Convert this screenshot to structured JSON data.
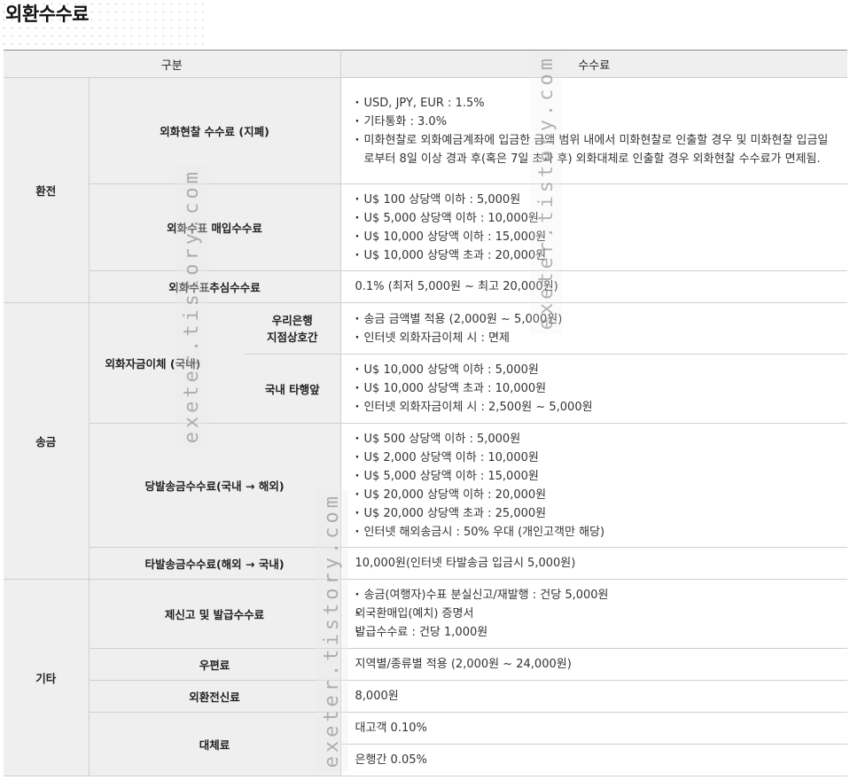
{
  "page": {
    "title": "외환수수료"
  },
  "header": {
    "col1": "구분",
    "col2": "수수료"
  },
  "categories": {
    "exchange": "환전",
    "remit": "송금",
    "other": "기타"
  },
  "rows": {
    "r1": {
      "label": "외화현찰 수수료 (지폐)",
      "items": [
        "USD, JPY, EUR : 1.5%",
        "기타통화 : 3.0%",
        "미화현찰로 외화예금계좌에 입금한 금액 범위 내에서 미화현찰로 인출할 경우 및 미화현찰 입금일로부터 8일 이상 경과 후(혹은 7일 초과 후) 외화대체로 인출할 경우 외화현찰 수수료가 면제됨."
      ]
    },
    "r2": {
      "label": "외화수표 매입수수료",
      "items": [
        "U$ 100 상당액 이하 : 5,000원",
        "U$ 5,000 상당액 이하 : 10,000원",
        "U$ 10,000 상당액 이하 : 15,000원",
        "U$ 10,000 상당액 초과 : 20,000원"
      ]
    },
    "r3": {
      "label": "외화수표추심수수료",
      "text": "0.1% (최저 5,000원 ~ 최고 20,000원)"
    },
    "r4": {
      "label": "외화자금이체 (국내)",
      "sub1": "우리은행\n지점상호간",
      "items1": [
        "송금 금액별 적용 (2,000원 ~ 5,000원)",
        "인터넷 외화자금이체 시 : 면제"
      ],
      "sub2": "국내 타행앞",
      "items2": [
        "U$ 10,000 상당액 이하 : 5,000원",
        "U$ 10,000 상당액 초과 : 10,000원",
        "인터넷 외화자금이체 시 : 2,500원 ~ 5,000원"
      ]
    },
    "r5": {
      "label": "당발송금수수료(국내 → 해외)",
      "items": [
        "U$ 500 상당액 이하 : 5,000원",
        "U$ 2,000 상당액 이하 : 10,000원",
        "U$ 5,000 상당액 이하 : 15,000원",
        "U$ 20,000 상당액 이하 : 20,000원",
        "U$ 20,000 상당액 초과 : 25,000원",
        "인터넷 해외송금시 : 50% 우대 (개인고객만 해당)"
      ]
    },
    "r6": {
      "label": "타발송금수수료(해외 → 국내)",
      "text": "10,000원(인터넷 타발송금 입금시 5,000원)"
    },
    "r7": {
      "label": "제신고 및 발급수수료",
      "items": [
        "송금(여행자)수표 분실신고/재발행 : 건당 5,000원",
        "외국환매입(예치) 증명서",
        "발급수수료 : 건당 1,000원"
      ]
    },
    "r8": {
      "label": "우편료",
      "text": "지역별/종류별 적용 (2,000원 ~ 24,000원)"
    },
    "r9": {
      "label": "외환전신료",
      "text": "8,000원"
    },
    "r10": {
      "label": "대체료",
      "text1": "대고객 0.10%",
      "text2": "은행간 0.05%"
    }
  },
  "watermark": {
    "text": "exeter.tistory.com"
  }
}
